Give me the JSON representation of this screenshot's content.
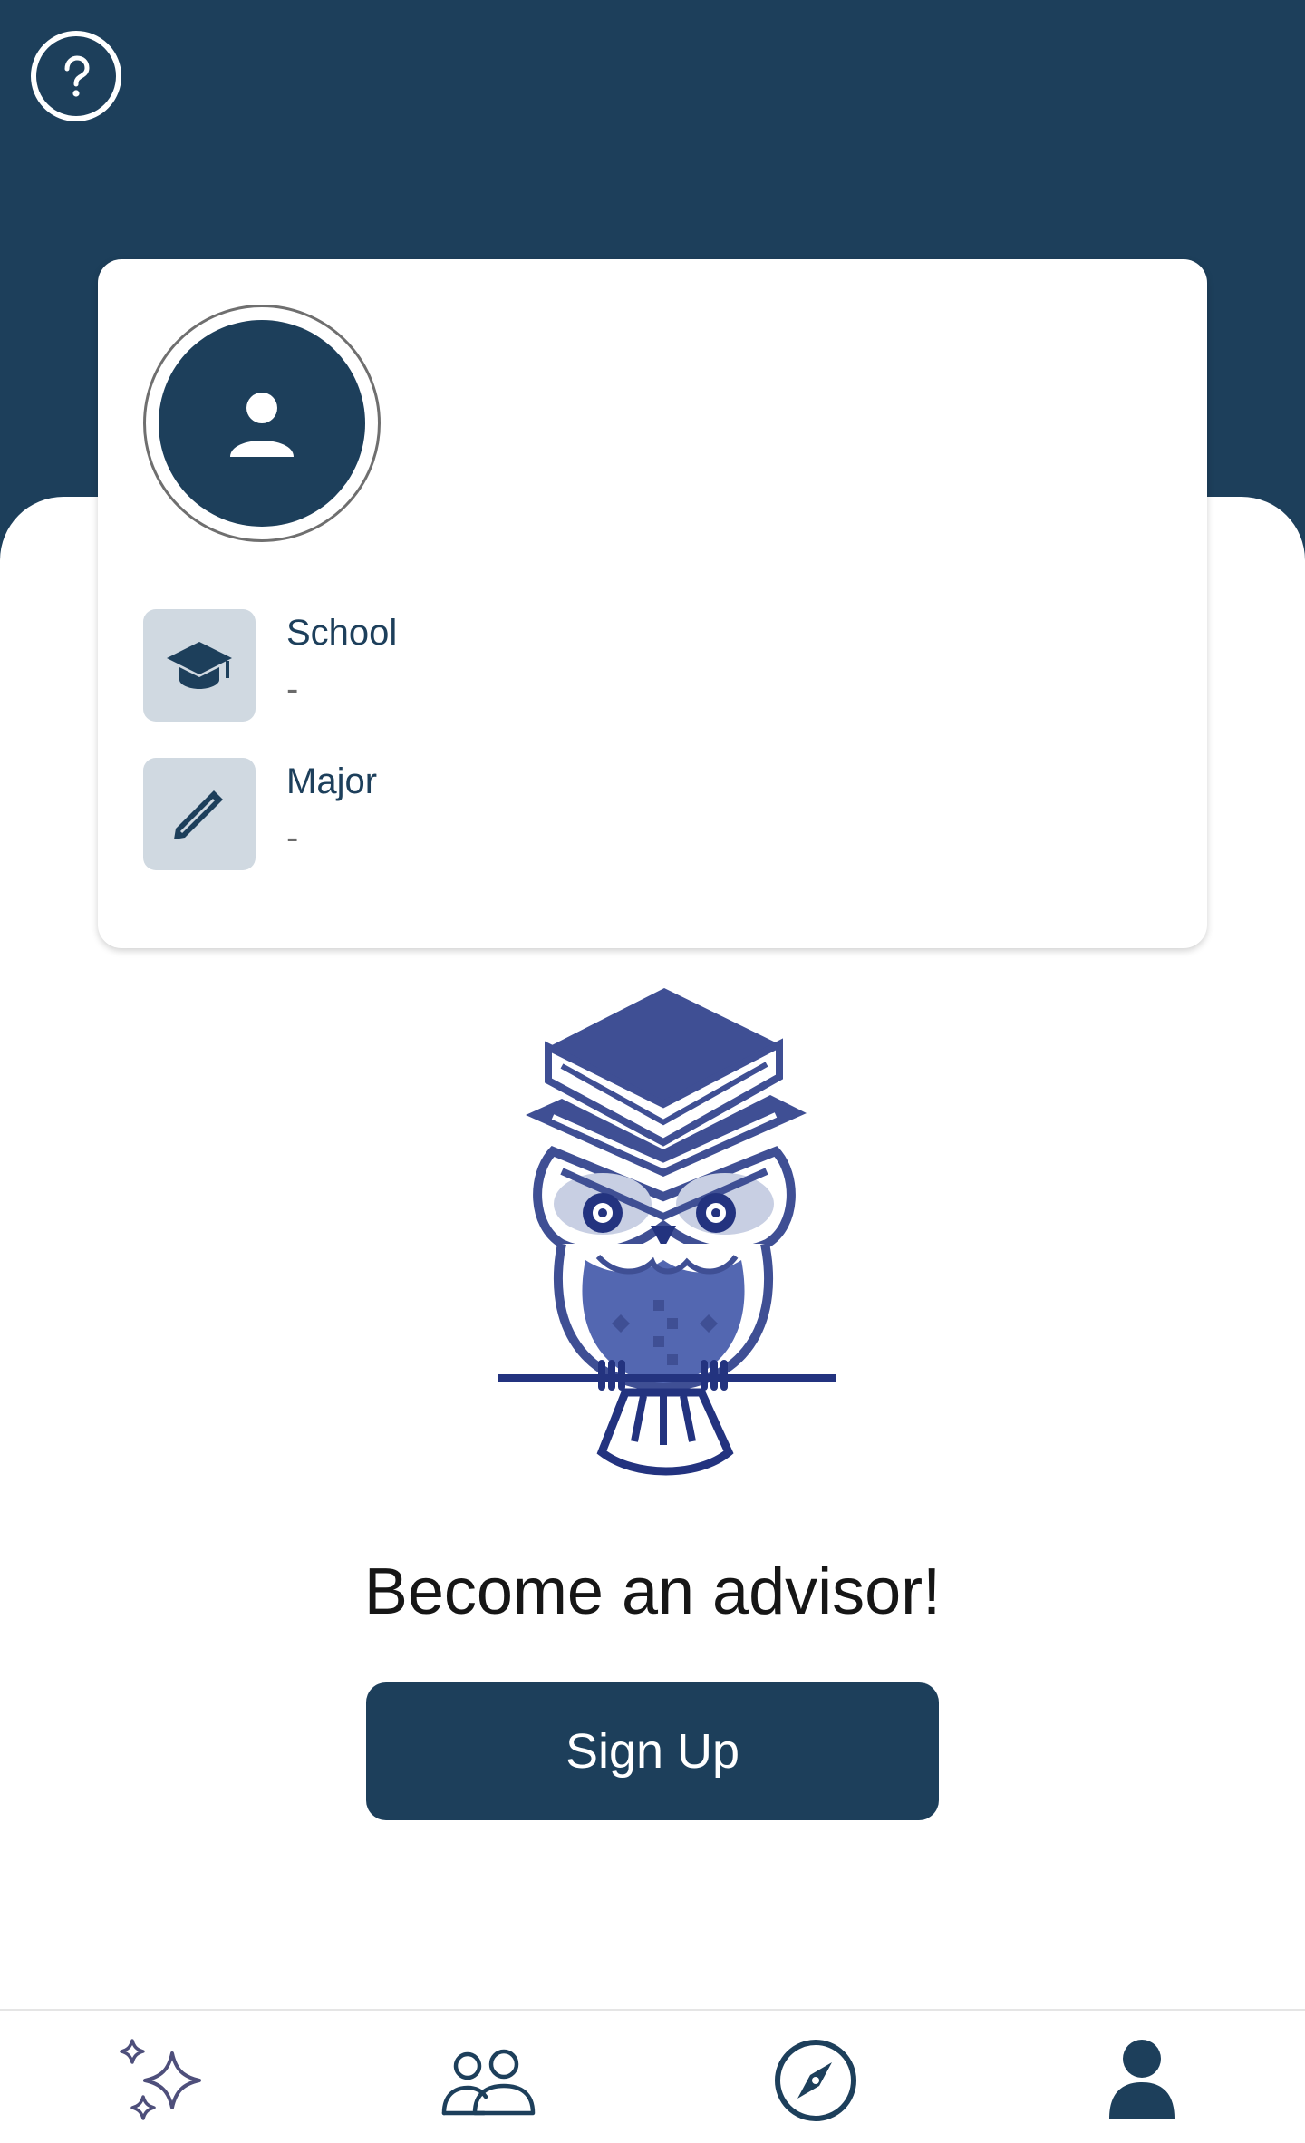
{
  "header": {
    "help_icon": "question-circle-icon"
  },
  "profile_card": {
    "avatar_icon": "person-icon",
    "school": {
      "icon": "graduation-cap-icon",
      "label": "School",
      "value": "-"
    },
    "major": {
      "icon": "pencil-icon",
      "label": "Major",
      "value": "-"
    }
  },
  "advisor_cta": {
    "illustration": "owl-graduate-icon",
    "title": "Become an advisor!",
    "button_label": "Sign Up"
  },
  "bottom_nav": {
    "items": [
      {
        "icon": "sparkles-icon"
      },
      {
        "icon": "people-icon"
      },
      {
        "icon": "compass-icon"
      },
      {
        "icon": "person-icon"
      }
    ]
  },
  "colors": {
    "primary": "#1d3f5b",
    "icon_box": "#d0d9e1",
    "owl_blue": "#3f4f94",
    "owl_dark": "#23337f",
    "nav_sparkle": "#4e4f7b"
  }
}
